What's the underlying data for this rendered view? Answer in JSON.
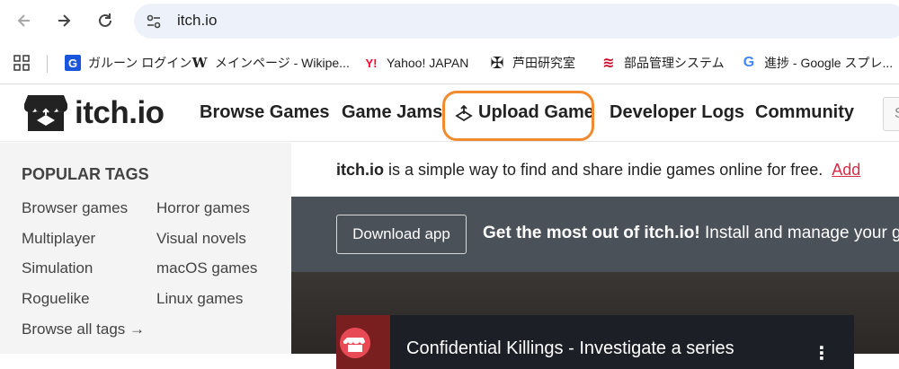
{
  "browser": {
    "url": "itch.io",
    "bookmarks": [
      {
        "label": "ガルーン ログイン",
        "icon": "garoon-icon",
        "glyph": "G",
        "color": "#1a56db"
      },
      {
        "label": "メインページ - Wikipe...",
        "icon": "wikipedia-icon",
        "glyph": "W",
        "color": "#222222"
      },
      {
        "label": "Yahoo! JAPAN",
        "icon": "yahoo-icon",
        "glyph": "Y!",
        "color": "#ff0033"
      },
      {
        "label": "芦田研究室",
        "icon": "lab-icon",
        "glyph": "✠",
        "color": "#222222"
      },
      {
        "label": "部品管理システム",
        "icon": "parts-system-icon",
        "glyph": "≋",
        "color": "#c8102e"
      },
      {
        "label": "進捗 - Google スプレ...",
        "icon": "google-icon",
        "glyph": "G",
        "color": "#4285f4"
      }
    ]
  },
  "header": {
    "logo_text": "itch.io",
    "nav": {
      "browse": "Browse Games",
      "jams": "Game Jams",
      "upload": "Upload Game",
      "devlogs": "Developer Logs",
      "community": "Community"
    },
    "search_placeholder": "S"
  },
  "sidebar": {
    "heading": "POPULAR TAGS",
    "tags_left": [
      "Browser games",
      "Multiplayer",
      "Simulation",
      "Roguelike",
      "Browse all tags →"
    ],
    "tags_right": [
      "Horror games",
      "Visual novels",
      "macOS games",
      "Linux games"
    ]
  },
  "main": {
    "tagline_brand": "itch.io",
    "tagline_rest": " is a simple way to find and share indie games online for free.",
    "tagline_link": "Add",
    "banner": {
      "button": "Download app",
      "bold": "Get the most out of itch.io!",
      "rest": " Install and manage your g"
    },
    "video_title": "Confidential Killings - Investigate a series"
  },
  "colors": {
    "accent": "#da2c49",
    "highlight": "#f28a2e",
    "banner_bg": "#4b5159",
    "sidebar_bg": "#f4f4f4"
  }
}
